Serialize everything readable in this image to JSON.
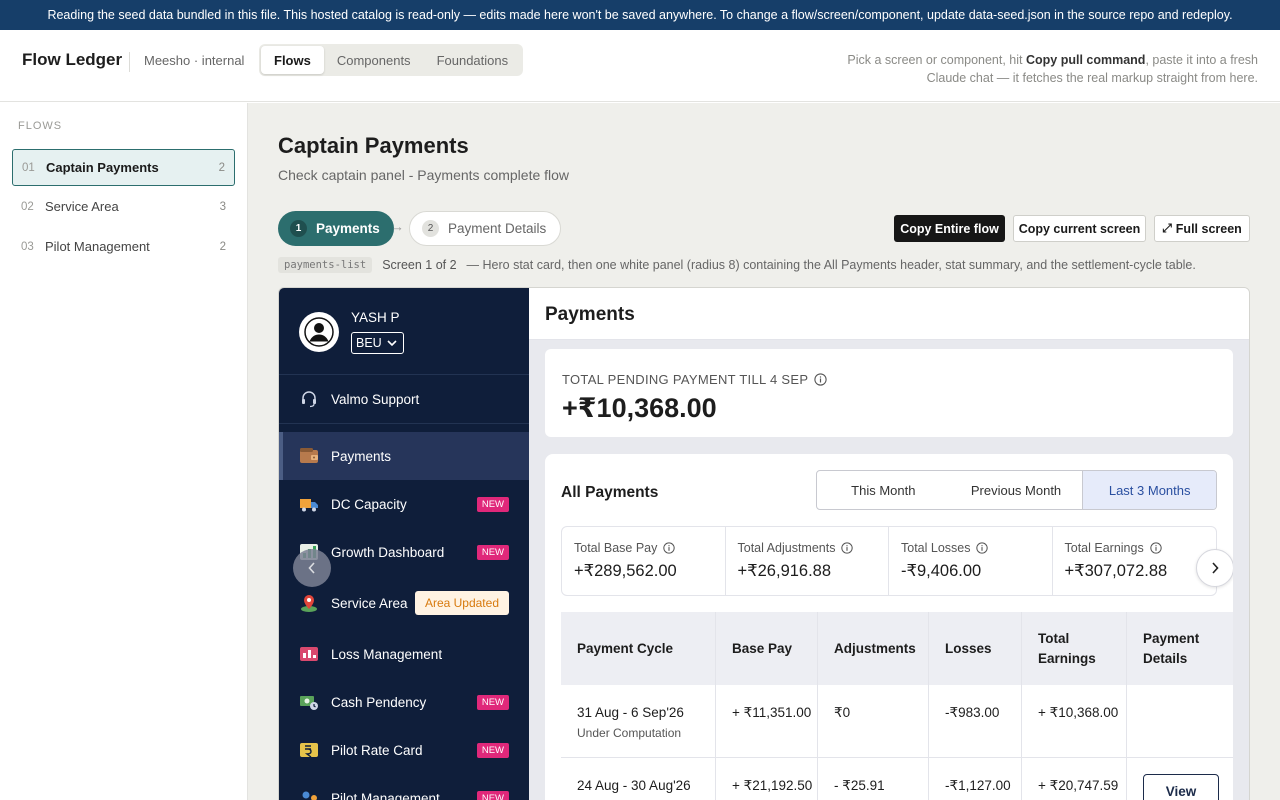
{
  "banner": {
    "text": "Reading the seed data bundled in this file. This hosted catalog is read-only — edits made here won't be saved anywhere. To change a flow/screen/component, update data-seed.json in the source repo and redeploy."
  },
  "header": {
    "brand": "Flow Ledger",
    "org": "Meesho · internal",
    "tabs": [
      "Flows",
      "Components",
      "Foundations"
    ],
    "hint_pre": "Pick a screen or component, hit ",
    "hint_bold": "Copy pull command",
    "hint_post": ", paste it into a fresh Claude chat — it fetches the real markup straight from here."
  },
  "sidebar": {
    "heading": "FLOWS",
    "items": [
      {
        "num": "01",
        "label": "Captain Payments",
        "count": "2"
      },
      {
        "num": "02",
        "label": "Service Area",
        "count": "3"
      },
      {
        "num": "03",
        "label": "Pilot Management",
        "count": "2"
      }
    ]
  },
  "main": {
    "title": "Captain Payments",
    "subtitle": "Check captain panel - Payments complete flow",
    "steps": [
      {
        "num": "1",
        "label": "Payments"
      },
      {
        "num": "2",
        "label": "Payment Details"
      }
    ],
    "step_arrow": "→",
    "actions": {
      "copy_flow": "Copy Entire flow",
      "copy_screen": "Copy current screen",
      "fullscreen": "Full screen"
    },
    "meta": {
      "code": "payments-list",
      "screen": "Screen 1 of 2",
      "description": "— Hero stat card, then one white panel (radius 8) containing the All Payments header, stat summary, and the settlement-cycle table."
    }
  },
  "preview": {
    "user": {
      "name": "YASH P",
      "role": "BEU"
    },
    "nav": [
      {
        "label": "Valmo Support",
        "icon": "headset-icon"
      },
      {
        "label": "Payments",
        "icon": "wallet-icon"
      },
      {
        "label": "DC Capacity",
        "icon": "truck-icon",
        "badge": "NEW"
      },
      {
        "label": "Growth Dashboard",
        "icon": "chart-icon",
        "badge": "NEW"
      },
      {
        "label": "Service Area",
        "icon": "map-pin-icon",
        "badge": "Area Updated"
      },
      {
        "label": "Loss Management",
        "icon": "loss-icon"
      },
      {
        "label": "Cash Pendency",
        "icon": "cash-icon",
        "badge": "NEW"
      },
      {
        "label": "Pilot Rate Card",
        "icon": "rate-card-icon",
        "badge": "NEW"
      },
      {
        "label": "Pilot Management",
        "icon": "pilot-icon",
        "badge": "NEW"
      }
    ],
    "page_title": "Payments",
    "hero": {
      "label": "TOTAL PENDING PAYMENT TILL 4 SEP",
      "value": "+₹10,368.00"
    },
    "panel": {
      "title": "All Payments",
      "periods": [
        "This Month",
        "Previous Month",
        "Last 3 Months"
      ],
      "stats": [
        {
          "label": "Total Base Pay",
          "value": "+₹289,562.00"
        },
        {
          "label": "Total Adjustments",
          "value": "+₹26,916.88"
        },
        {
          "label": "Total Losses",
          "value": "-₹9,406.00"
        },
        {
          "label": "Total Earnings",
          "value": "+₹307,072.88"
        }
      ],
      "columns": [
        "Payment Cycle",
        "Base Pay",
        "Adjustments",
        "Losses",
        "Total Earnings",
        "Payment Details"
      ],
      "rows": [
        {
          "cycle": "31 Aug - 6 Sep'26",
          "status": "Under Computation",
          "base": "+ ₹11,351.00",
          "adj": "₹0",
          "loss": "-₹983.00",
          "total": "+ ₹10,368.00",
          "action": ""
        },
        {
          "cycle": "24 Aug - 30 Aug'26",
          "status": "",
          "base": "+ ₹21,192.50",
          "adj": "- ₹25.91",
          "loss": "-₹1,127.00",
          "total": "+ ₹20,747.59",
          "action": "View"
        }
      ]
    }
  },
  "colors": {
    "banner": "#163e69",
    "accent_teal": "#2c6e6e",
    "nav_bg": "#0f1e3a",
    "badge_new": "#e0287a",
    "badge_area": "#d77a0e",
    "period_active": "#2a4fa0"
  }
}
